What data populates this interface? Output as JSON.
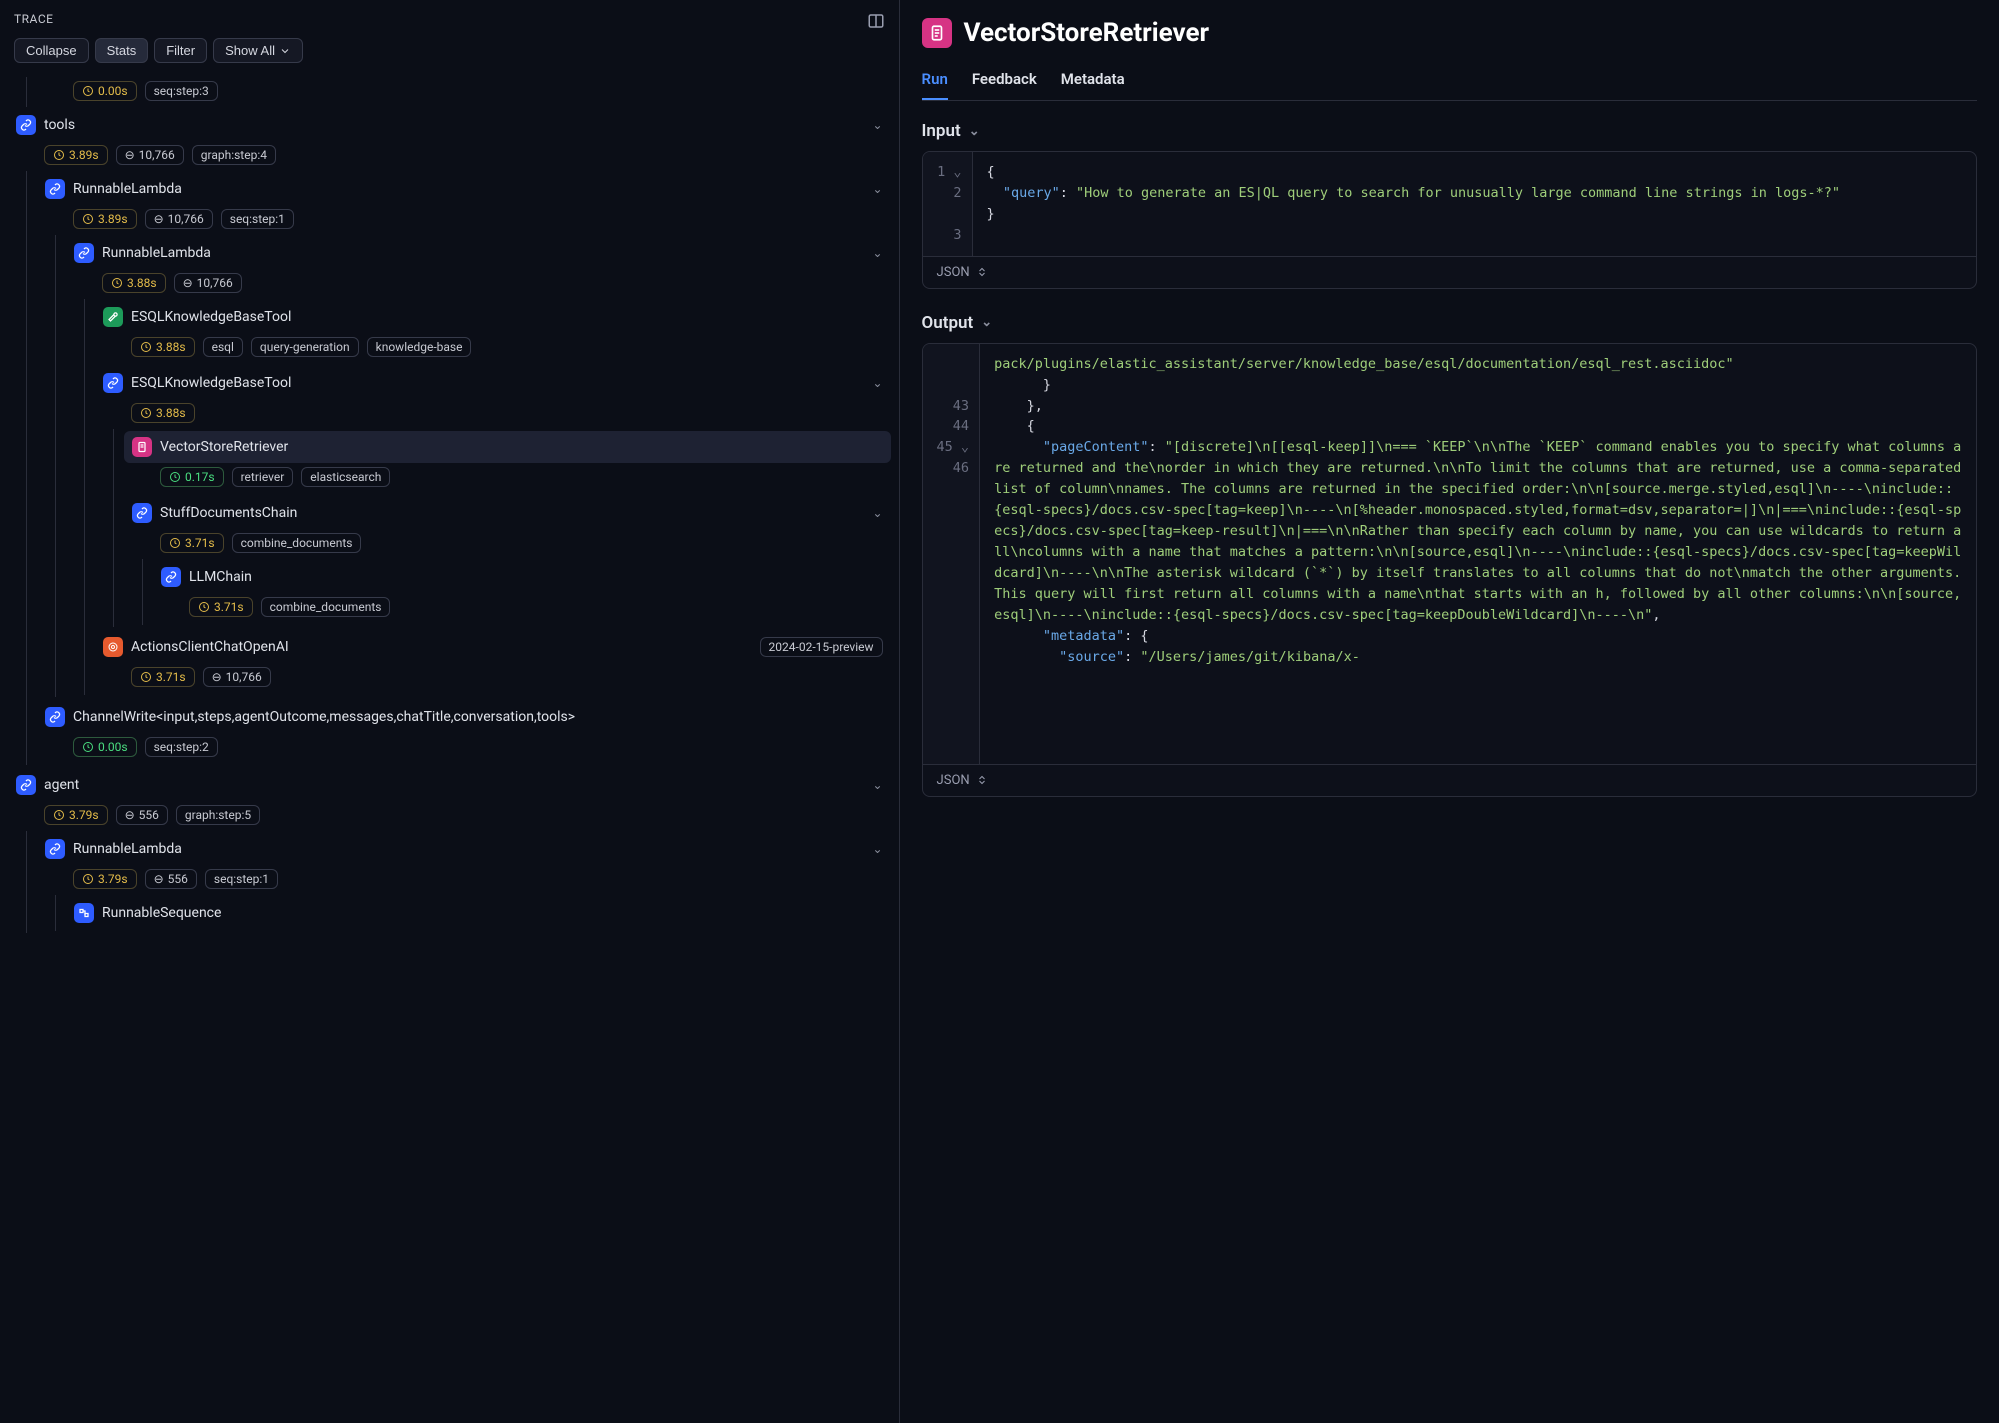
{
  "trace": {
    "title": "TRACE",
    "controls": {
      "collapse": "Collapse",
      "stats": "Stats",
      "filter": "Filter",
      "showall": "Show All"
    },
    "nodes": {
      "n0_time": "0.00s",
      "n0_tag": "seq:step:3",
      "tools": "tools",
      "tools_time": "3.89s",
      "tools_tokens": "10,766",
      "tools_tag": "graph:step:4",
      "rl1": "RunnableLambda",
      "rl1_time": "3.89s",
      "rl1_tokens": "10,766",
      "rl1_tag": "seq:step:1",
      "rl2": "RunnableLambda",
      "rl2_time": "3.88s",
      "rl2_tokens": "10,766",
      "esql1": "ESQLKnowledgeBaseTool",
      "esql1_time": "3.88s",
      "esql1_tag1": "esql",
      "esql1_tag2": "query-generation",
      "esql1_tag3": "knowledge-base",
      "esql2": "ESQLKnowledgeBaseTool",
      "esql2_time": "3.88s",
      "vsr": "VectorStoreRetriever",
      "vsr_time": "0.17s",
      "vsr_tag1": "retriever",
      "vsr_tag2": "elasticsearch",
      "stuff": "StuffDocumentsChain",
      "stuff_time": "3.71s",
      "stuff_tag": "combine_documents",
      "llm": "LLMChain",
      "llm_time": "3.71s",
      "llm_tag": "combine_documents",
      "openai": "ActionsClientChatOpenAI",
      "openai_ver": "2024-02-15-preview",
      "openai_time": "3.71s",
      "openai_tokens": "10,766",
      "cwrite": "ChannelWrite<input,steps,agentOutcome,messages,chatTitle,conversation,tools>",
      "cwrite_time": "0.00s",
      "cwrite_tag": "seq:step:2",
      "agent": "agent",
      "agent_time": "3.79s",
      "agent_tokens": "556",
      "agent_tag": "graph:step:5",
      "rl3": "RunnableLambda",
      "rl3_time": "3.79s",
      "rl3_tokens": "556",
      "rl3_tag": "seq:step:1",
      "rseq": "RunnableSequence"
    }
  },
  "detail": {
    "title": "VectorStoreRetriever",
    "tabs": {
      "run": "Run",
      "feedback": "Feedback",
      "metadata": "Metadata"
    },
    "input_label": "Input",
    "output_label": "Output",
    "json_label": "JSON",
    "input_code": {
      "l1": "{",
      "l2a": "\"query\"",
      "l2b": ": ",
      "l2c": "\"How to generate an ES|QL query to search for unusually large command line strings in logs-*?\"",
      "l3": "}"
    },
    "output": {
      "top": "pack/plugins/elastic_assistant/server/knowledge_base/esql/documentation/esql_rest.asciidoc\"",
      "l43": "      }",
      "l44": "    },",
      "l45": "    {",
      "l46_key": "\"pageContent\"",
      "l46_val": "\"[discrete]\\n[[esql-keep]]\\n=== `KEEP`\\n\\nThe `KEEP` command enables you to specify what columns are returned and the\\norder in which they are returned.\\n\\nTo limit the columns that are returned, use a comma-separated list of column\\nnames. The columns are returned in the specified order:\\n\\n[source.merge.styled,esql]\\n----\\ninclude::{esql-specs}/docs.csv-spec[tag=keep]\\n----\\n[%header.monospaced.styled,format=dsv,separator=|]\\n|===\\ninclude::{esql-specs}/docs.csv-spec[tag=keep-result]\\n|===\\n\\nRather than specify each column by name, you can use wildcards to return all\\ncolumns with a name that matches a pattern:\\n\\n[source,esql]\\n----\\ninclude::{esql-specs}/docs.csv-spec[tag=keepWildcard]\\n----\\n\\nThe asterisk wildcard (`*`) by itself translates to all columns that do not\\nmatch the other arguments. This query will first return all columns with a name\\nthat starts with an h, followed by all other columns:\\n\\n[source,esql]\\n----\\ninclude::{esql-specs}/docs.csv-spec[tag=keepDoubleWildcard]\\n----\\n\"",
      "l47_key": "\"metadata\"",
      "l47_rest": ": {",
      "l48_key": "\"source\"",
      "l48_val": "\"/Users/james/git/kibana/x-"
    }
  }
}
